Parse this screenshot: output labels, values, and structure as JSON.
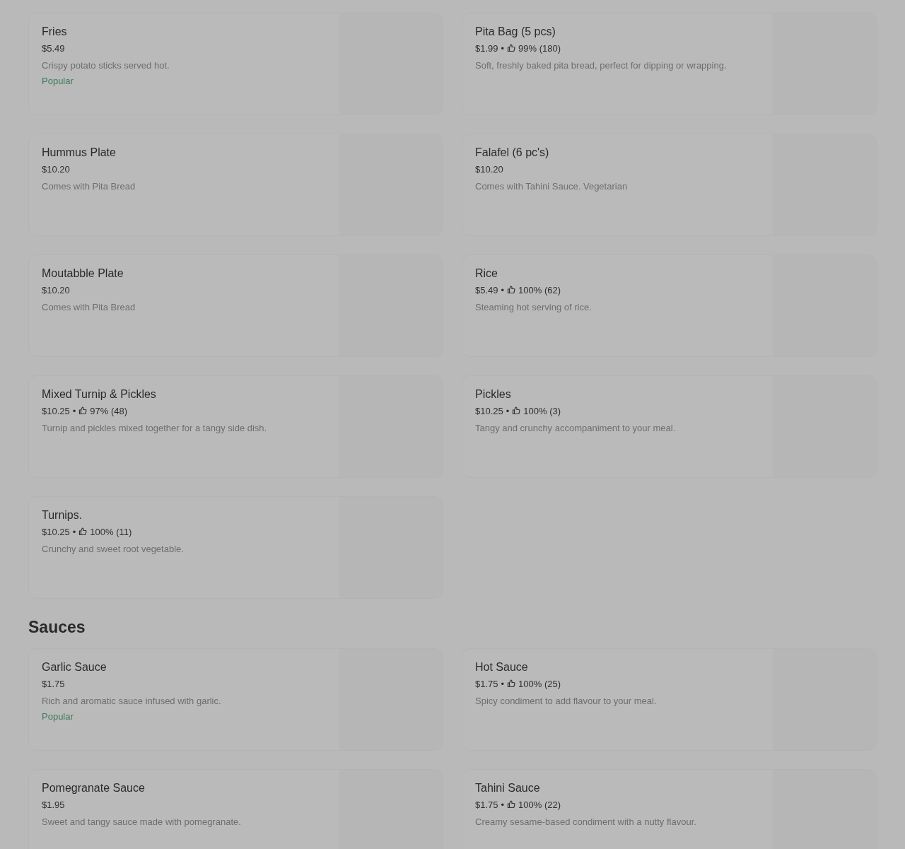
{
  "sections": [
    {
      "items": [
        {
          "name": "Fries",
          "price": "$5.49",
          "description": "Crispy potato sticks served hot.",
          "badge": "Popular"
        },
        {
          "name": "Pita Bag (5 pcs)",
          "price": "$1.99",
          "separator": "•",
          "rating": "99% (180)",
          "description": "Soft, freshly baked pita bread, perfect for dipping or wrapping."
        },
        {
          "name": "Hummus Plate",
          "price": "$10.20",
          "description": "Comes with Pita Bread"
        },
        {
          "name": "Falafel (6 pc's)",
          "price": "$10.20",
          "description": "Comes with Tahini Sauce. Vegetarian"
        },
        {
          "name": "Moutabble Plate",
          "price": "$10.20",
          "description": "Comes with Pita Bread"
        },
        {
          "name": "Rice",
          "price": "$5.49",
          "separator": "•",
          "rating": "100% (62)",
          "description": "Steaming hot serving of rice."
        },
        {
          "name": "Mixed Turnip & Pickles",
          "price": "$10.25",
          "separator": "•",
          "rating": "97% (48)",
          "description": "Turnip and pickles mixed together for a tangy side dish."
        },
        {
          "name": "Pickles",
          "price": "$10.25",
          "separator": "•",
          "rating": "100% (3)",
          "description": "Tangy and crunchy accompaniment to your meal."
        },
        {
          "name": "Turnips.",
          "price": "$10.25",
          "separator": "•",
          "rating": "100% (11)",
          "description": "Crunchy and sweet root vegetable."
        }
      ]
    },
    {
      "title": "Sauces",
      "items": [
        {
          "name": "Garlic Sauce",
          "price": "$1.75",
          "description": "Rich and aromatic sauce infused with garlic.",
          "badge": "Popular"
        },
        {
          "name": "Hot Sauce",
          "price": "$1.75",
          "separator": "•",
          "rating": "100% (25)",
          "description": "Spicy condiment to add flavour to your meal."
        },
        {
          "name": "Pomegranate Sauce",
          "price": "$1.95",
          "description": "Sweet and tangy sauce made with pomegranate."
        },
        {
          "name": "Tahini Sauce",
          "price": "$1.75",
          "separator": "•",
          "rating": "100% (22)",
          "description": "Creamy sesame-based condiment with a nutty flavour."
        }
      ]
    }
  ]
}
